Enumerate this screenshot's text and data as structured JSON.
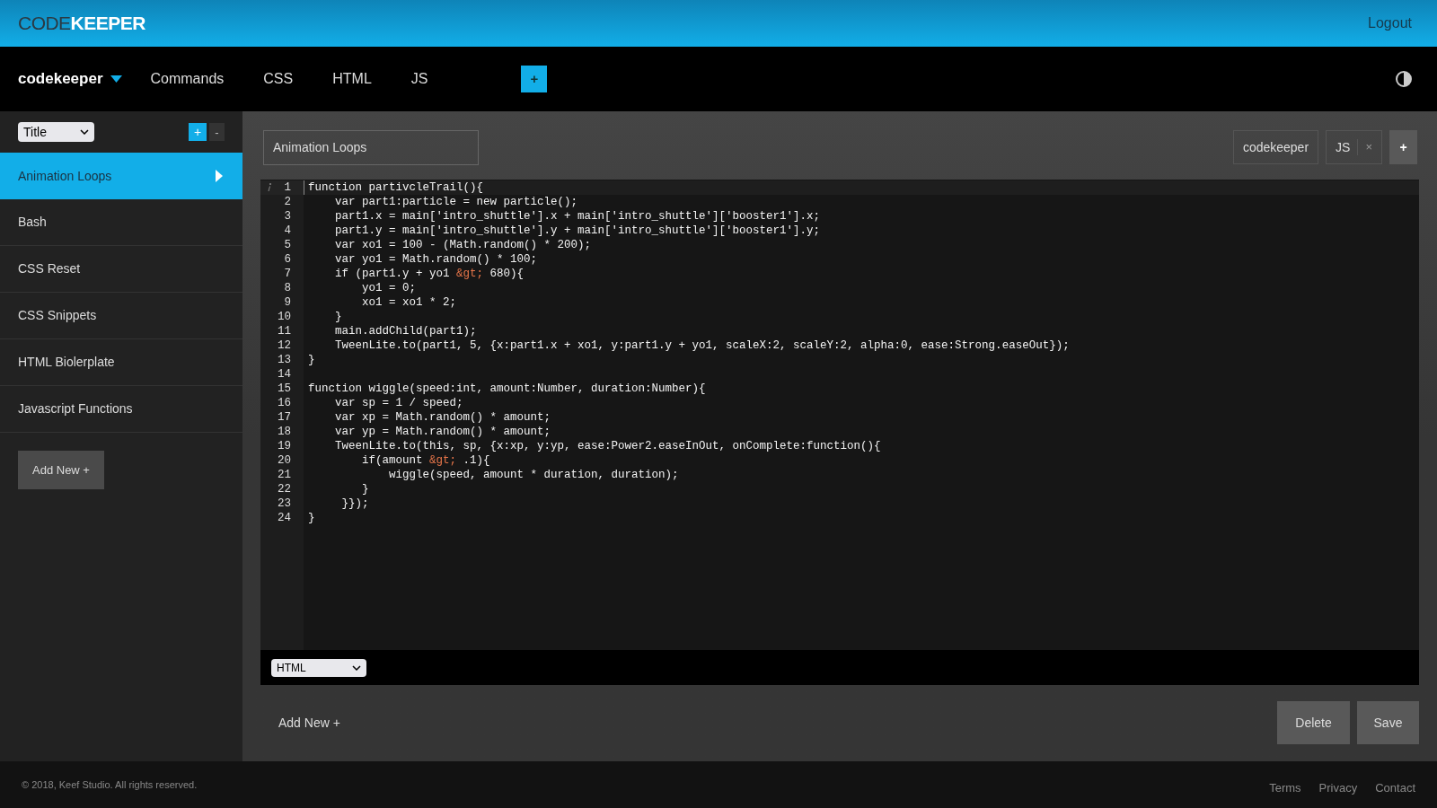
{
  "header": {
    "logo_light": "CODE",
    "logo_bold": "KEEPER",
    "logout": "Logout"
  },
  "nav": {
    "brand": "codekeeper",
    "items": [
      "Commands",
      "CSS",
      "HTML",
      "JS"
    ],
    "add": "+"
  },
  "sidebar": {
    "sort_select": "Title",
    "add": "+",
    "remove": "-",
    "items": [
      {
        "label": "Animation Loops",
        "selected": true
      },
      {
        "label": "Bash",
        "selected": false
      },
      {
        "label": "CSS Reset",
        "selected": false
      },
      {
        "label": "CSS Snippets",
        "selected": false
      },
      {
        "label": "HTML Biolerplate",
        "selected": false
      },
      {
        "label": "Javascript Functions",
        "selected": false
      }
    ],
    "add_new": "Add New +"
  },
  "editor": {
    "title": "Animation Loops",
    "tags": [
      {
        "label": "codekeeper",
        "removable": false
      },
      {
        "label": "JS",
        "removable": true,
        "remove": "×"
      }
    ],
    "add_tag": "+",
    "lines": [
      {
        "number": "1",
        "active": true,
        "segments": [
          {
            "kind": "plain",
            "text": "function partivcleTrail(){"
          }
        ]
      },
      {
        "number": "2",
        "active": false,
        "segments": [
          {
            "kind": "plain",
            "text": "    var part1:particle = new particle();"
          }
        ]
      },
      {
        "number": "3",
        "active": false,
        "segments": [
          {
            "kind": "plain",
            "text": "    part1.x = main['intro_shuttle'].x + main['intro_shuttle']['booster1'].x;"
          }
        ]
      },
      {
        "number": "4",
        "active": false,
        "segments": [
          {
            "kind": "plain",
            "text": "    part1.y = main['intro_shuttle'].y + main['intro_shuttle']['booster1'].y;"
          }
        ]
      },
      {
        "number": "5",
        "active": false,
        "segments": [
          {
            "kind": "plain",
            "text": "    var xo1 = 100 - (Math.random() * 200);"
          }
        ]
      },
      {
        "number": "6",
        "active": false,
        "segments": [
          {
            "kind": "plain",
            "text": "    var yo1 = Math.random() * 100;"
          }
        ]
      },
      {
        "number": "7",
        "active": false,
        "segments": [
          {
            "kind": "plain",
            "text": "    if (part1.y + yo1 "
          },
          {
            "kind": "entity",
            "text": "&gt;"
          },
          {
            "kind": "plain",
            "text": " 680){"
          }
        ]
      },
      {
        "number": "8",
        "active": false,
        "segments": [
          {
            "kind": "plain",
            "text": "        yo1 = 0;"
          }
        ]
      },
      {
        "number": "9",
        "active": false,
        "segments": [
          {
            "kind": "plain",
            "text": "        xo1 = xo1 * 2;"
          }
        ]
      },
      {
        "number": "10",
        "active": false,
        "segments": [
          {
            "kind": "plain",
            "text": "    }"
          }
        ]
      },
      {
        "number": "11",
        "active": false,
        "segments": [
          {
            "kind": "plain",
            "text": "    main.addChild(part1);"
          }
        ]
      },
      {
        "number": "12",
        "active": false,
        "segments": [
          {
            "kind": "plain",
            "text": "    TweenLite.to(part1, 5, {x:part1.x + xo1, y:part1.y + yo1, scaleX:2, scaleY:2, alpha:0, ease:Strong.easeOut});"
          }
        ]
      },
      {
        "number": "13",
        "active": false,
        "segments": [
          {
            "kind": "plain",
            "text": "}"
          }
        ]
      },
      {
        "number": "14",
        "active": false
      },
      {
        "number": "15",
        "active": false,
        "segments": [
          {
            "kind": "plain",
            "text": "function wiggle(speed:int, amount:Number, duration:Number){"
          }
        ]
      },
      {
        "number": "16",
        "active": false,
        "segments": [
          {
            "kind": "plain",
            "text": "    var sp = 1 / speed;"
          }
        ]
      },
      {
        "number": "17",
        "active": false,
        "segments": [
          {
            "kind": "plain",
            "text": "    var xp = Math.random() * amount;"
          }
        ]
      },
      {
        "number": "18",
        "active": false,
        "segments": [
          {
            "kind": "plain",
            "text": "    var yp = Math.random() * amount;"
          }
        ]
      },
      {
        "number": "19",
        "active": false,
        "segments": [
          {
            "kind": "plain",
            "text": "    TweenLite.to(this, sp, {x:xp, y:yp, ease:Power2.easeInOut, onComplete:function(){"
          }
        ]
      },
      {
        "number": "20",
        "active": false,
        "segments": [
          {
            "kind": "plain",
            "text": "        if(amount "
          },
          {
            "kind": "entity",
            "text": "&gt;"
          },
          {
            "kind": "plain",
            "text": " .1){"
          }
        ]
      },
      {
        "number": "21",
        "active": false,
        "segments": [
          {
            "kind": "plain",
            "text": "            wiggle(speed, amount * duration, duration);"
          }
        ]
      },
      {
        "number": "22",
        "active": false,
        "segments": [
          {
            "kind": "plain",
            "text": "        }"
          }
        ]
      },
      {
        "number": "23",
        "active": false,
        "segments": [
          {
            "kind": "plain",
            "text": "     }});"
          }
        ]
      },
      {
        "number": "24",
        "active": false,
        "segments": [
          {
            "kind": "plain",
            "text": "}"
          }
        ]
      }
    ],
    "mode_select": "HTML",
    "add_new": "Add New +",
    "delete": "Delete",
    "save": "Save"
  },
  "footer": {
    "copyright": "© 2018, Keef Studio. All rights reserved.",
    "links": [
      "Terms",
      "Privacy",
      "Contact"
    ]
  }
}
